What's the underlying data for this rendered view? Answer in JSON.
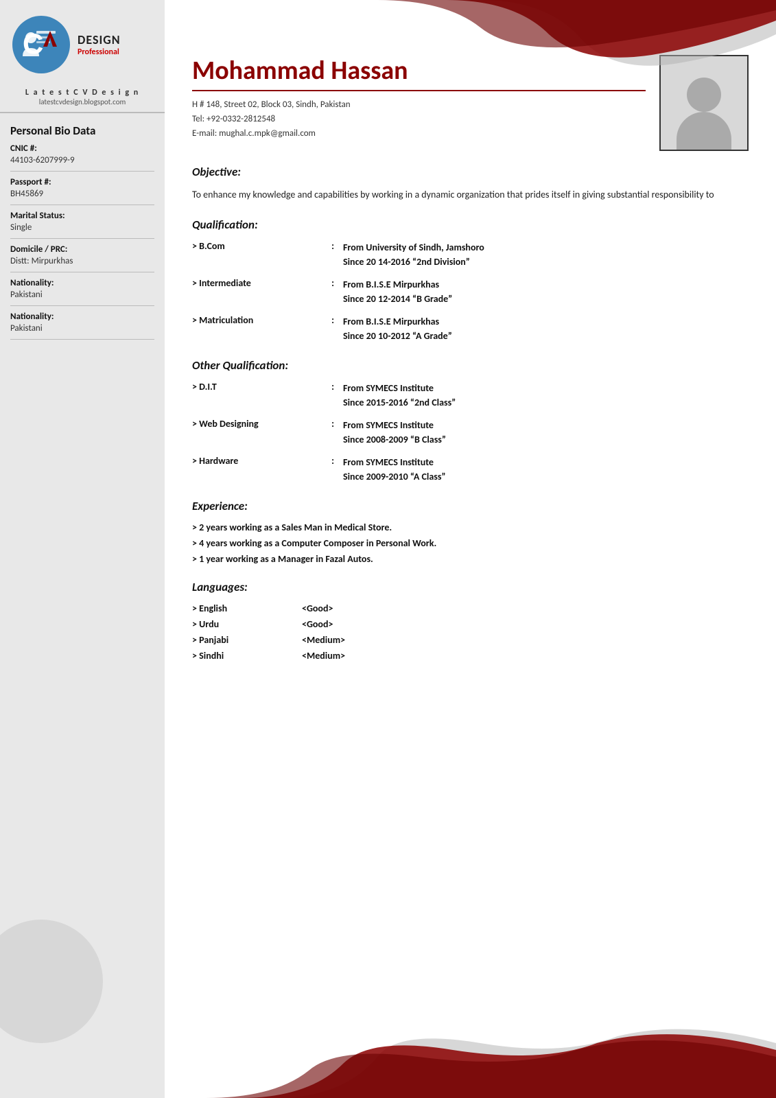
{
  "logo": {
    "design_label": "DESIGN",
    "professional_label": "Professional",
    "site_name": "L a t e s t  C V  D e s i g n",
    "site_url": "latestcvdesign.blogspot.com"
  },
  "sidebar": {
    "bio_title": "Personal Bio Data",
    "fields": [
      {
        "label": "CNIC #:",
        "value": "44103-6207999-9"
      },
      {
        "label": "Passport #:",
        "value": "BH45869"
      },
      {
        "label": "Marital Status:",
        "value": "Single"
      },
      {
        "label": "Domicile / PRC:",
        "value": "Distt: Mirpurkhas"
      },
      {
        "label": "Nationality:",
        "value": "Pakistani"
      },
      {
        "label": "Nationality:",
        "value": "Pakistani"
      }
    ]
  },
  "header": {
    "full_name": "Mohammad Hassan",
    "address": "H # 148, Street 02, Block 03, Sindh, Pakistan",
    "tel": "Tel: +92-0332-2812548",
    "email": "E-mail: mughal.c.mpk@gmail.com"
  },
  "objective": {
    "title": "Objective:",
    "text": "To enhance my knowledge and capabilities by working in a dynamic organization that prides itself in giving substantial responsibility to"
  },
  "qualification": {
    "title": "Qualification:",
    "items": [
      {
        "degree": "> B.Com",
        "colon": ":",
        "details": "From University of Sindh, Jamshoro\nSince 20 14-2016 “2nd Division”"
      },
      {
        "degree": "> Intermediate",
        "colon": ":",
        "details": "From B.I.S.E Mirpurkhas\nSince 20 12-2014 “B Grade”"
      },
      {
        "degree": "> Matriculation",
        "colon": ":",
        "details": "From B.I.S.E Mirpurkhas\nSince 20 10-2012 “A Grade”"
      }
    ]
  },
  "other_qualification": {
    "title": "Other Qualification:",
    "items": [
      {
        "degree": "> D.I.T",
        "colon": ":",
        "details": "From SYMECS Institute\nSince 2015-2016 “2nd Class”"
      },
      {
        "degree": "> Web Designing",
        "colon": ":",
        "details": "From SYMECS Institute\nSince 2008-2009 “B Class”"
      },
      {
        "degree": "> Hardware",
        "colon": ":",
        "details": "From SYMECS Institute\nSince 2009-2010 “A Class”"
      }
    ]
  },
  "experience": {
    "title": "Experience:",
    "items": [
      "> 2 years working as a Sales Man in Medical Store.",
      "> 4 years working as a Computer Composer in Personal Work.",
      "> 1 year working as a Manager in Fazal Autos."
    ]
  },
  "languages": {
    "title": "Languages:",
    "items": [
      {
        "lang": "> English",
        "level": "<Good>"
      },
      {
        "lang": "> Urdu",
        "level": "<Good>"
      },
      {
        "lang": "> Panjabi",
        "level": "<Medium>"
      },
      {
        "lang": "> Sindhi",
        "level": "<Medium>"
      }
    ]
  }
}
